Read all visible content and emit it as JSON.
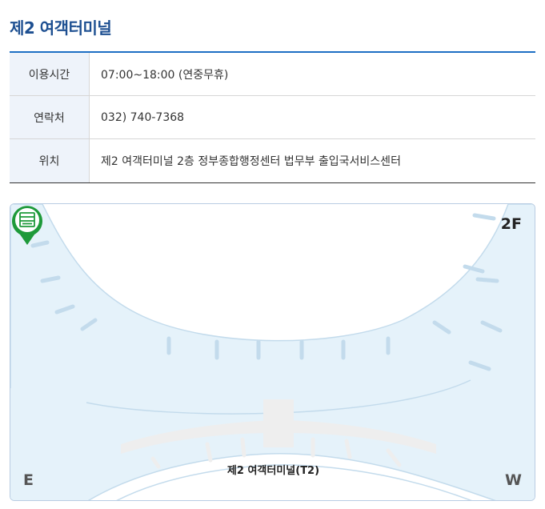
{
  "page": {
    "title": "제2 여객터미널"
  },
  "info": {
    "rows": [
      {
        "label": "이용시간",
        "value": "07:00~18:00 (연중무휴)"
      },
      {
        "label": "연락처",
        "value": "032) 740-7368"
      },
      {
        "label": "위치",
        "value": "제2 여객터미널 2층 정부종합행정센터 법무부 출입국서비스센터"
      }
    ]
  },
  "map": {
    "floor": "2F",
    "east_label": "E",
    "west_label": "W",
    "terminal_label": "제2 여객터미널(T2)",
    "pin_icon": "office-building-icon",
    "colors": {
      "water": "#e5f2fa",
      "outline": "#c3dbec",
      "pin": "#1e9a3a",
      "title": "#1d4f91",
      "accent_line": "#1d6fc4"
    }
  }
}
